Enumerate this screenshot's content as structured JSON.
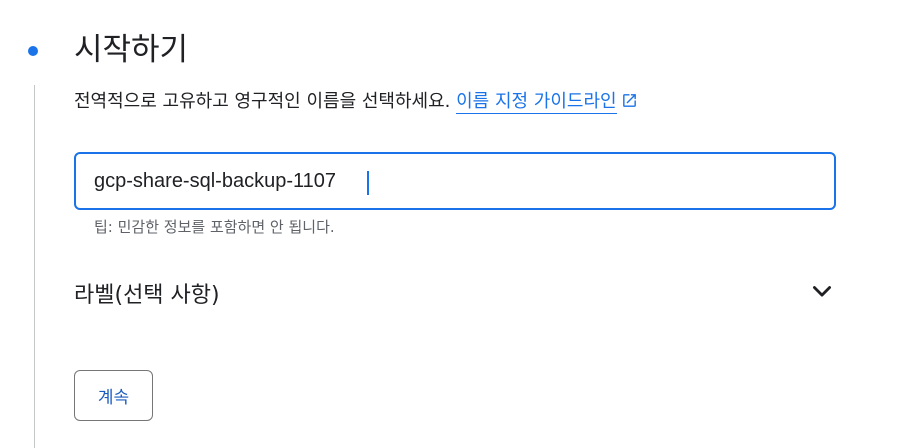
{
  "step": {
    "title": "시작하기",
    "description": "전역적으로 고유하고 영구적인 이름을 선택하세요.",
    "guide_link": "이름 지정 가이드라인"
  },
  "name_input": {
    "value": "gcp-share-sql-backup-1107",
    "hint": "팁: 민감한 정보를 포함하면 안 됩니다."
  },
  "labels_section": {
    "title": "라벨(선택 사항)"
  },
  "continue_button": {
    "label": "계속"
  },
  "colors": {
    "accent": "#1a73e8",
    "text": "#202124",
    "muted": "#5f6368"
  },
  "icons": [
    "step-dot-icon",
    "external-link-icon",
    "chevron-down-icon"
  ]
}
